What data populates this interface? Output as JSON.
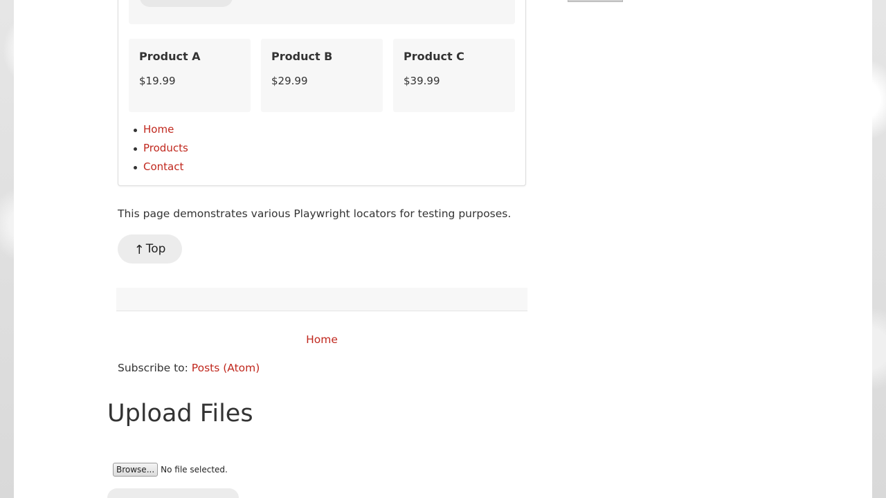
{
  "products": [
    {
      "name": "Product A",
      "price": "$19.99"
    },
    {
      "name": "Product B",
      "price": "$29.99"
    },
    {
      "name": "Product C",
      "price": "$39.99"
    }
  ],
  "nav": {
    "items": [
      {
        "label": "Home"
      },
      {
        "label": "Products"
      },
      {
        "label": "Contact"
      }
    ]
  },
  "description": "This page demonstrates various Playwright locators for testing purposes.",
  "top_button": {
    "arrow": "↑",
    "label": "Top"
  },
  "footer": {
    "home_link": "Home",
    "subscribe_prefix": "Subscribe to: ",
    "subscribe_link": "Posts (Atom)"
  },
  "upload": {
    "title": "Upload Files",
    "browse_label": "Browse...",
    "file_status": "No file selected."
  },
  "colors": {
    "link": "#c0271d",
    "panel": "#f7f7f7",
    "button": "#ececec"
  }
}
